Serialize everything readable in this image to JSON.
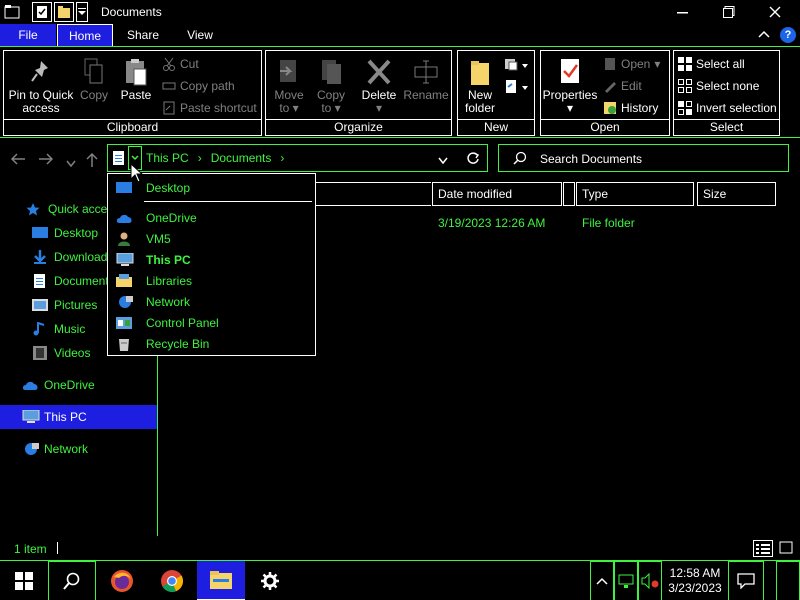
{
  "window": {
    "title": "Documents",
    "controls": {
      "minimize": "—",
      "maximize": "❐",
      "close": "✕"
    }
  },
  "tabs": [
    {
      "label": "File"
    },
    {
      "label": "Home"
    },
    {
      "label": "Share"
    },
    {
      "label": "View"
    }
  ],
  "ribbon": {
    "clipboard": {
      "label": "Clipboard",
      "pin": "Pin to Quick access",
      "pin_line1": "Pin to Quick",
      "pin_line2": "access",
      "copy": "Copy",
      "paste": "Paste",
      "cut": "Cut",
      "copy_path": "Copy path",
      "paste_shortcut": "Paste shortcut"
    },
    "organize": {
      "label": "Organize",
      "move_to_line1": "Move",
      "move_to_line2": "to",
      "copy_to_line1": "Copy",
      "copy_to_line2": "to",
      "delete": "Delete",
      "rename": "Rename"
    },
    "new": {
      "label": "New",
      "new_folder_line1": "New",
      "new_folder_line2": "folder"
    },
    "open": {
      "label": "Open",
      "properties": "Properties",
      "open": "Open",
      "edit": "Edit",
      "history": "History"
    },
    "select": {
      "label": "Select",
      "select_all": "Select all",
      "select_none": "Select none",
      "invert_selection": "Invert selection"
    }
  },
  "address": {
    "crumbs": [
      "This PC",
      "Documents"
    ],
    "separator": "›"
  },
  "search": {
    "placeholder": "Search Documents"
  },
  "nav": {
    "quick_access": "Quick access",
    "items": [
      "Desktop",
      "Downloads",
      "Documents",
      "Pictures",
      "Music",
      "Videos"
    ],
    "onedrive": "OneDrive",
    "this_pc": "This PC",
    "network": "Network"
  },
  "columns": {
    "date_modified": "Date modified",
    "type": "Type",
    "size": "Size"
  },
  "files": [
    {
      "name": "",
      "date_modified": "3/19/2023 12:26 AM",
      "type": "File folder",
      "size": ""
    }
  ],
  "dropdown": {
    "items": [
      {
        "label": "Desktop",
        "icon": "desktop-icon"
      },
      {
        "label": "OneDrive",
        "icon": "onedrive-icon"
      },
      {
        "label": "VM5",
        "icon": "user-icon"
      },
      {
        "label": "This PC",
        "icon": "this-pc-icon"
      },
      {
        "label": "Libraries",
        "icon": "libraries-icon"
      },
      {
        "label": "Network",
        "icon": "network-icon"
      },
      {
        "label": "Control Panel",
        "icon": "control-panel-icon"
      },
      {
        "label": "Recycle Bin",
        "icon": "recycle-bin-icon"
      }
    ]
  },
  "status": {
    "count": "1 item"
  },
  "taskbar": {
    "time": "12:58 AM",
    "date": "3/23/2023"
  },
  "colors": {
    "accent_green": "#3ff23f",
    "selection_blue": "#1e1ee0",
    "background": "#000000"
  }
}
